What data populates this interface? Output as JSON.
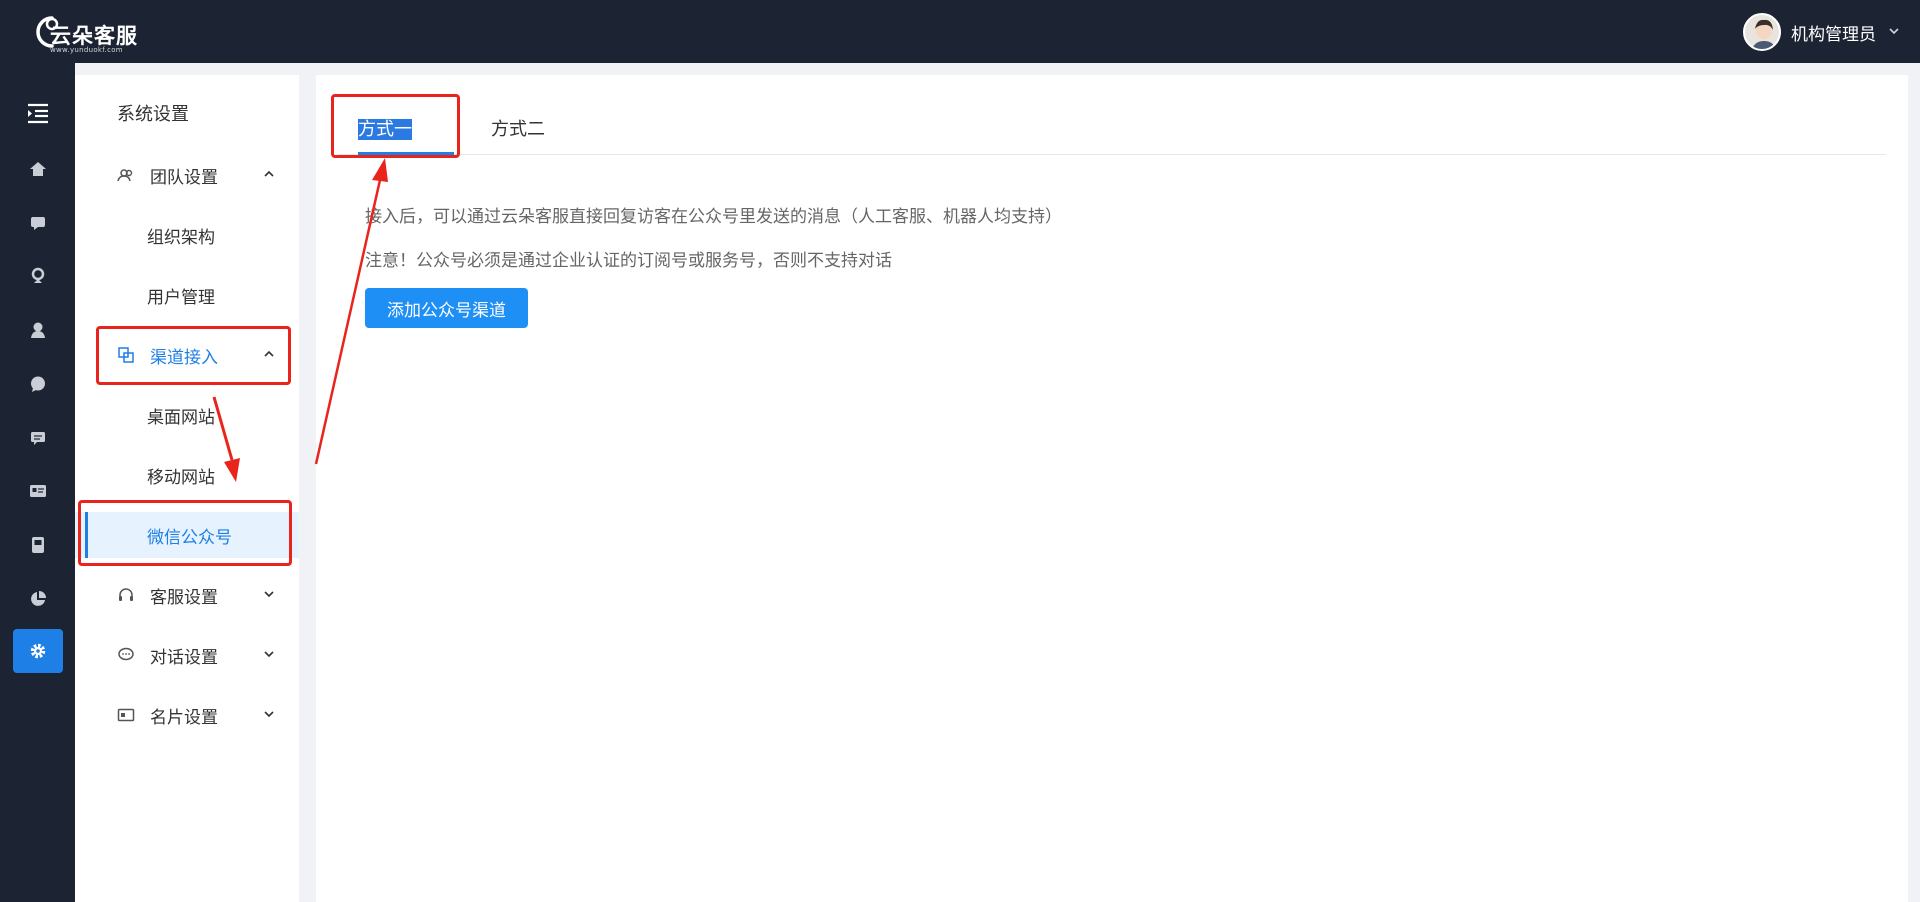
{
  "topbar": {
    "brand_name": "云朵客服",
    "brand_url": "www.yunduokf.com",
    "user_name": "机构管理员"
  },
  "rail": {
    "icons": [
      "menu-toggle-icon",
      "home-icon",
      "chat-icon",
      "visitor-icon",
      "customer-icon",
      "message-icon",
      "comment-icon",
      "card-icon",
      "phone-icon",
      "pie-chart-icon",
      "settings-gear-icon"
    ],
    "active_index": 10
  },
  "sidebar": {
    "title": "系统设置",
    "groups": [
      {
        "label": "团队设置",
        "icon": "team-icon",
        "expanded": true,
        "children": [
          "组织架构",
          "用户管理"
        ]
      },
      {
        "label": "渠道接入",
        "icon": "channel-icon",
        "expanded": true,
        "children": [
          "桌面网站",
          "移动网站",
          "微信公众号"
        ]
      },
      {
        "label": "客服设置",
        "icon": "headset-icon",
        "expanded": false
      },
      {
        "label": "对话设置",
        "icon": "dialog-icon",
        "expanded": false
      },
      {
        "label": "名片设置",
        "icon": "namecard-icon",
        "expanded": false
      }
    ],
    "active_child": "微信公众号"
  },
  "main": {
    "tabs": [
      {
        "label": "方式一",
        "active": true
      },
      {
        "label": "方式二",
        "active": false
      }
    ],
    "note_1": "接入后，可以通过云朵客服直接回复访客在公众号里发送的消息（人工客服、机器人均支持）",
    "note_2": "注意！公众号必须是通过企业认证的订阅号或服务号，否则不支持对话",
    "add_button": "添加公众号渠道"
  },
  "colors": {
    "dark_nav": "#1c2333",
    "accent": "#1e7fe6",
    "annotation_red": "#e8241d"
  }
}
